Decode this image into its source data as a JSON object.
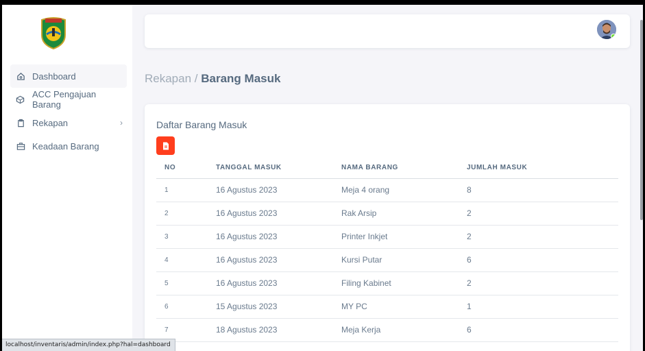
{
  "sidebar": {
    "items": [
      {
        "label": "Dashboard",
        "icon": "home-icon"
      },
      {
        "label": "ACC Pengajuan Barang",
        "icon": "cube-icon"
      },
      {
        "label": "Rekapan",
        "icon": "clipboard-icon"
      },
      {
        "label": "Keadaan Barang",
        "icon": "briefcase-icon"
      }
    ]
  },
  "breadcrumb": {
    "parent": "Rekapan /",
    "current": "Barang Masuk"
  },
  "card": {
    "title": "Daftar Barang Masuk",
    "columns": [
      "NO",
      "TANGGAL MASUK",
      "NAMA BARANG",
      "JUMLAH MASUK"
    ],
    "rows": [
      [
        "1",
        "16 Agustus 2023",
        "Meja 4 orang",
        "8"
      ],
      [
        "2",
        "16 Agustus 2023",
        "Rak Arsip",
        "2"
      ],
      [
        "3",
        "16 Agustus 2023",
        "Printer Inkjet",
        "2"
      ],
      [
        "4",
        "16 Agustus 2023",
        "Kursi Putar",
        "6"
      ],
      [
        "5",
        "16 Agustus 2023",
        "Filing Kabinet",
        "2"
      ],
      [
        "6",
        "15 Agustus 2023",
        "MY PC",
        "1"
      ],
      [
        "7",
        "18 Agustus 2023",
        "Meja Kerja",
        "6"
      ]
    ]
  },
  "statusbar": {
    "url": "localhost/inventaris/admin/index.php?hal=dashboard"
  },
  "colors": {
    "accent_pdf": "#ff3e1d",
    "text": "#566a7f",
    "background": "#f5f5f9"
  }
}
